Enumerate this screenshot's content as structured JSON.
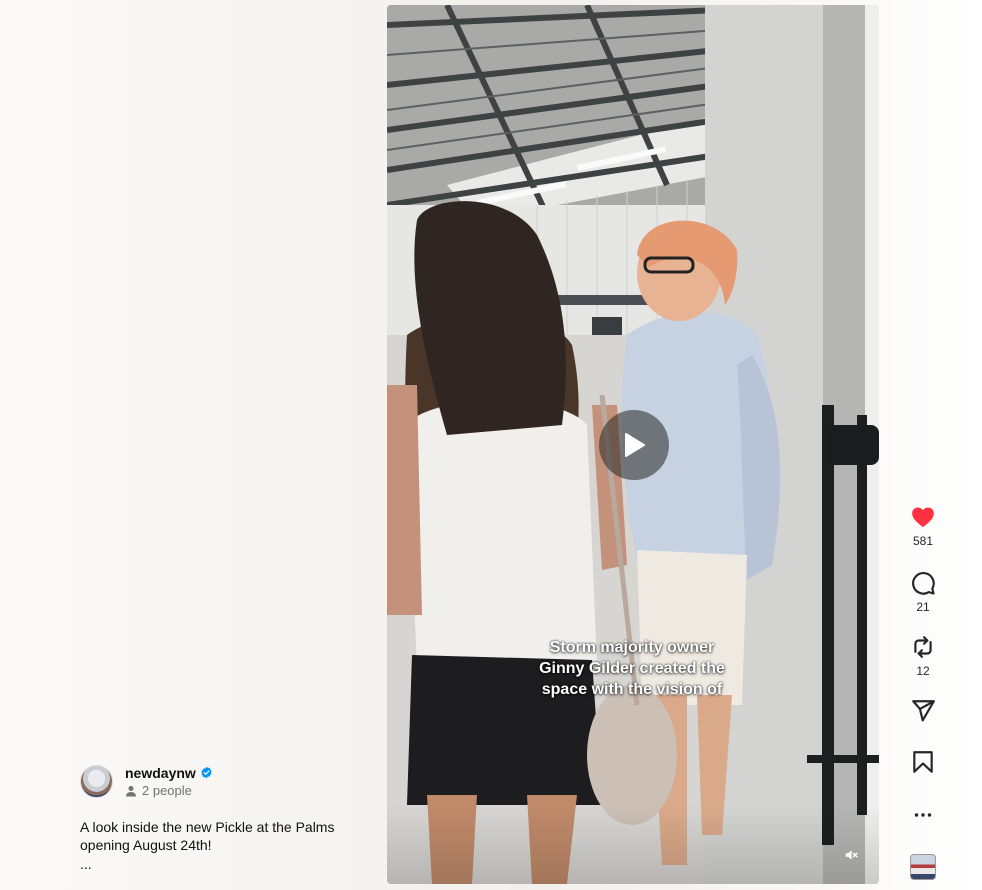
{
  "post": {
    "username": "newdaynw",
    "collaborators": "2 people",
    "caption_line1": "A look inside the new Pickle at the Palms",
    "caption_line2": "opening August 24th!",
    "more": "..."
  },
  "video": {
    "subtitle_line1": "Storm majority owner",
    "subtitle_line2": "Ginny Gilder created the",
    "subtitle_line3": "space with the vision of"
  },
  "actions": {
    "likes": "581",
    "comments": "21",
    "reposts": "12"
  },
  "icons": {
    "like": "heart-icon",
    "comment": "comment-icon",
    "repost": "repost-icon",
    "share": "share-icon",
    "save": "bookmark-icon",
    "more": "more-icon",
    "mute": "mute-icon",
    "play": "play-icon",
    "verified": "verified-badge-icon",
    "people": "person-icon"
  },
  "colors": {
    "like_red": "#ff3040",
    "verified_blue": "#0095f6",
    "muted_text": "#737373"
  }
}
